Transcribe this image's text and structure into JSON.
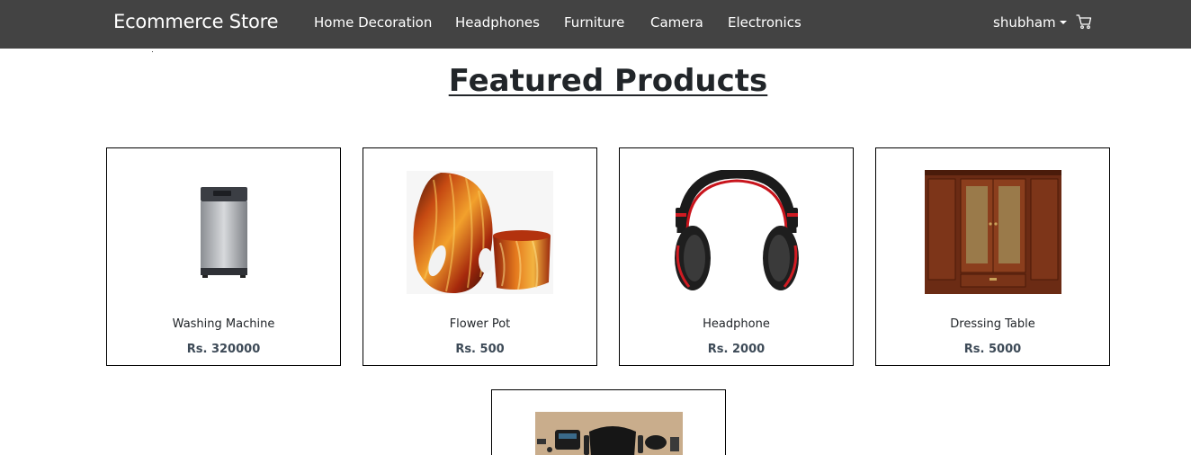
{
  "navbar": {
    "brand": "Ecommerce Store",
    "links": [
      "Home Decoration",
      "Headphones",
      "Furniture",
      "Camera",
      "Electronics"
    ],
    "user": "shubham",
    "icons": {
      "cart": "cart-icon",
      "caret": "caret-down-icon"
    }
  },
  "main": {
    "title": "Featured Products",
    "products": [
      {
        "name": "Washing Machine",
        "price": "Rs. 320000",
        "image": "washing-machine-image"
      },
      {
        "name": "Flower Pot",
        "price": "Rs. 500",
        "image": "flower-pot-image"
      },
      {
        "name": "Headphone",
        "price": "Rs. 2000",
        "image": "headphone-image"
      },
      {
        "name": "Dressing Table",
        "price": "Rs. 5000",
        "image": "dressing-table-image"
      },
      {
        "name": "",
        "price": "",
        "image": "electronics-kit-image"
      }
    ]
  },
  "colors": {
    "navbar": "#434343",
    "text": "#212529",
    "price": "#3d4a57"
  }
}
